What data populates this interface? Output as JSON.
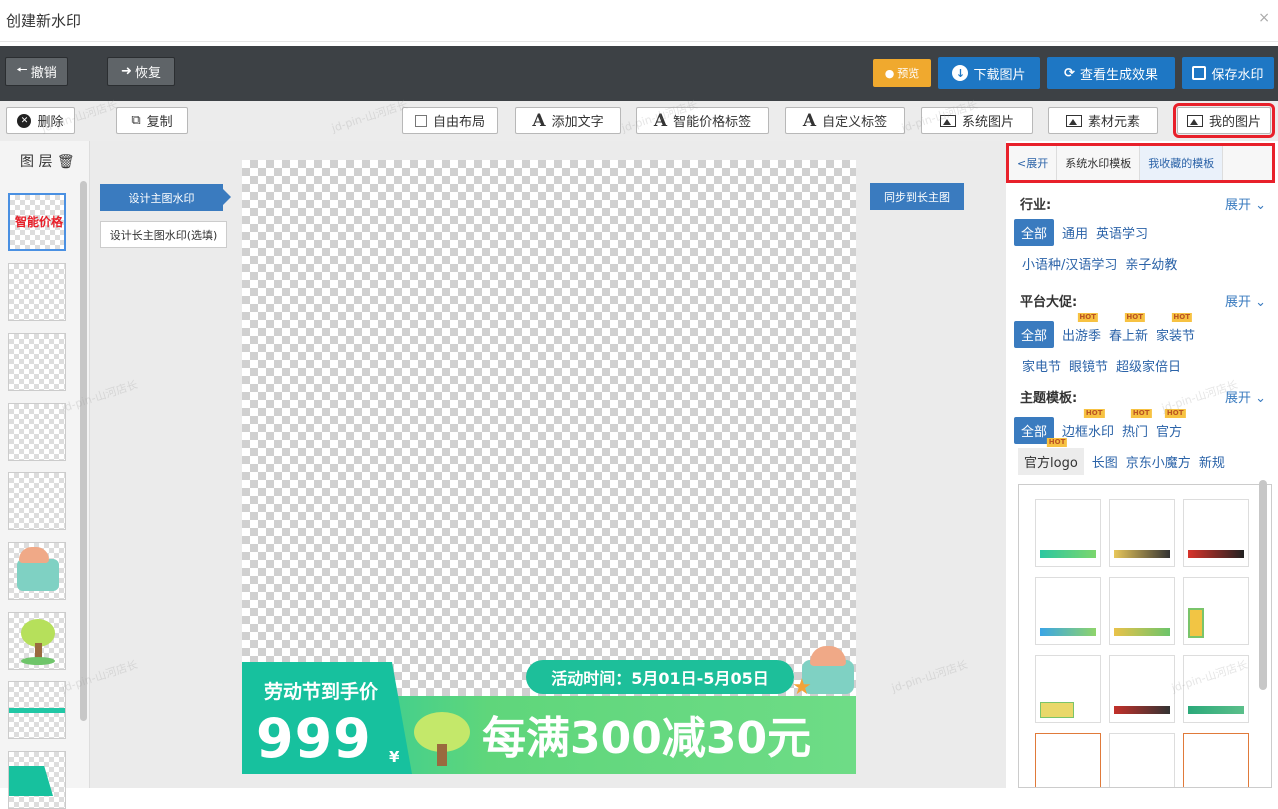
{
  "window": {
    "title": "创建新水印",
    "close_symbol": "×"
  },
  "topbar": {
    "undo_label": "撤销",
    "redo_label": "恢复",
    "preview_label": "预览",
    "download_label": "下载图片",
    "view_result_label": "查看生成效果",
    "save_label": "保存水印"
  },
  "toolbar": {
    "delete_label": "删除",
    "copy_label": "复制",
    "free_layout_label": "自由布局",
    "add_text_label": "添加文字",
    "smart_price_label": "智能价格标签",
    "custom_label_label": "自定义标签",
    "system_image_label": "系统图片",
    "material_label": "素材元素",
    "my_image_label": "我的图片",
    "text_icon_glyph": "A"
  },
  "layers": {
    "header": "图 层",
    "first_thumb_text": "智能价格"
  },
  "workspace": {
    "design_main_label": "设计主图水印",
    "design_long_label": "设计长主图水印(选填)",
    "sync_label": "同步到长主图"
  },
  "canvas": {
    "promo_title": "劳动节到手价",
    "price": "999",
    "currency": "¥",
    "slogan": "每满300减30元",
    "time_text": "活动时间：5月01日-5月05日"
  },
  "panel": {
    "tabs": [
      {
        "label": "<展开",
        "selected": false
      },
      {
        "label": "系统水印模板",
        "selected": false
      },
      {
        "label": "我收藏的模板",
        "selected": true
      }
    ],
    "expand_label": "展开",
    "industry": {
      "title": "行业:",
      "tags": [
        "全部",
        "通用",
        "英语学习",
        "小语种/汉语学习",
        "亲子幼教"
      ]
    },
    "promo": {
      "title": "平台大促:",
      "tags": [
        "全部",
        "出游季",
        "春上新",
        "家装节",
        "家电节",
        "眼镜节",
        "超级家倍日"
      ]
    },
    "theme": {
      "title": "主题模板:",
      "tags": [
        "全部",
        "边框水印",
        "热门",
        "官方",
        "官方logo",
        "长图",
        "京东小魔方",
        "新规"
      ]
    },
    "hot_badge": "HOT"
  },
  "watermark_text": "jd-pin-山河店长",
  "colors": {
    "accent_blue": "#1e77c4",
    "highlight_red": "#e8202a",
    "banner_green": "#1bc5a6",
    "orange": "#f0a92e"
  }
}
